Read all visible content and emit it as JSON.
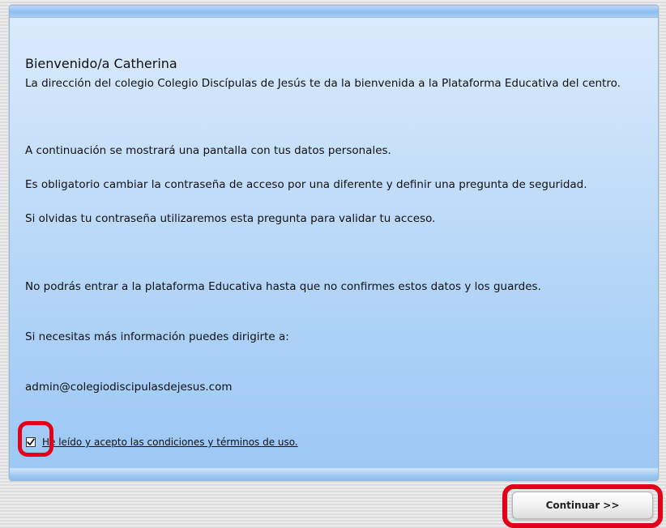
{
  "welcome": {
    "title": "Bienvenido/a Catherina",
    "intro": "La dirección del colegio Colegio Discípulas de Jesús te da la bienvenida a la Plataforma Educativa del centro."
  },
  "info": {
    "line1": "A continuación se mostrará una pantalla con tus datos personales.",
    "line2": "Es obligatorio cambiar la contraseña de acceso por una diferente y definir una pregunta de seguridad.",
    "line3": "Si olvidas tu contraseña utilizaremos esta pregunta para validar tu acceso.",
    "line4": "No podrás entrar a la plataforma Educativa hasta que no confirmes estos datos y los guardes.",
    "line5": "Si necesitas más información puedes dirigirte a:",
    "email": "admin@colegiodiscipulasdejesus.com"
  },
  "terms": {
    "label": "He leído y acepto las condiciones y términos de uso.",
    "checked": true
  },
  "actions": {
    "continue_label": "Continuar >>"
  },
  "colors": {
    "highlight": "#e3001b",
    "panel_top": "#dcebfd",
    "panel_bottom": "#9cc8f4"
  },
  "icons": {
    "checkbox": "check-icon"
  }
}
